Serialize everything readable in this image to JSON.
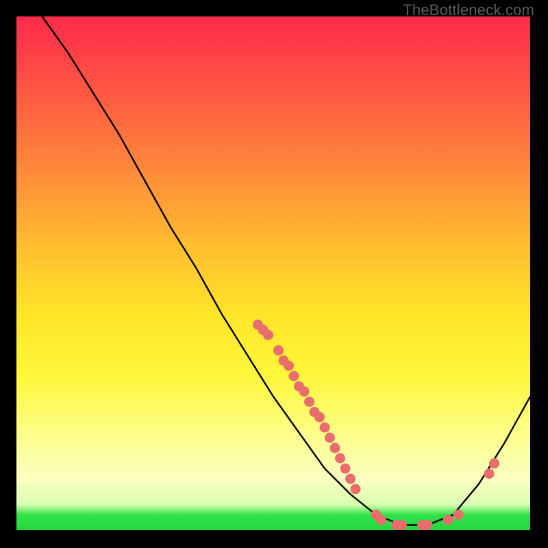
{
  "watermark": "TheBottleneck.com",
  "chart_data": {
    "type": "line",
    "title": "",
    "xlabel": "",
    "ylabel": "",
    "xlim": [
      0,
      100
    ],
    "ylim": [
      0,
      100
    ],
    "grid": false,
    "legend": false,
    "curve": [
      {
        "x": 5,
        "y": 100
      },
      {
        "x": 10,
        "y": 93
      },
      {
        "x": 15,
        "y": 85
      },
      {
        "x": 20,
        "y": 77
      },
      {
        "x": 25,
        "y": 68
      },
      {
        "x": 30,
        "y": 59
      },
      {
        "x": 35,
        "y": 51
      },
      {
        "x": 40,
        "y": 42
      },
      {
        "x": 45,
        "y": 34
      },
      {
        "x": 50,
        "y": 26
      },
      {
        "x": 55,
        "y": 19
      },
      {
        "x": 60,
        "y": 12
      },
      {
        "x": 65,
        "y": 7
      },
      {
        "x": 70,
        "y": 3
      },
      {
        "x": 75,
        "y": 1
      },
      {
        "x": 80,
        "y": 1
      },
      {
        "x": 85,
        "y": 3
      },
      {
        "x": 90,
        "y": 9
      },
      {
        "x": 95,
        "y": 17
      },
      {
        "x": 100,
        "y": 26
      }
    ],
    "data_points": [
      {
        "x": 47,
        "y": 40
      },
      {
        "x": 48,
        "y": 39
      },
      {
        "x": 49,
        "y": 38
      },
      {
        "x": 51,
        "y": 35
      },
      {
        "x": 52,
        "y": 33
      },
      {
        "x": 53,
        "y": 32
      },
      {
        "x": 54,
        "y": 30
      },
      {
        "x": 55,
        "y": 28
      },
      {
        "x": 56,
        "y": 27
      },
      {
        "x": 57,
        "y": 25
      },
      {
        "x": 58,
        "y": 23
      },
      {
        "x": 59,
        "y": 22
      },
      {
        "x": 60,
        "y": 20
      },
      {
        "x": 61,
        "y": 18
      },
      {
        "x": 62,
        "y": 16
      },
      {
        "x": 63,
        "y": 14
      },
      {
        "x": 64,
        "y": 12
      },
      {
        "x": 65,
        "y": 10
      },
      {
        "x": 66,
        "y": 8
      },
      {
        "x": 70,
        "y": 3
      },
      {
        "x": 71,
        "y": 2
      },
      {
        "x": 74,
        "y": 1
      },
      {
        "x": 75,
        "y": 1
      },
      {
        "x": 79,
        "y": 1
      },
      {
        "x": 80,
        "y": 1
      },
      {
        "x": 84,
        "y": 2
      },
      {
        "x": 86,
        "y": 3
      },
      {
        "x": 92,
        "y": 11
      },
      {
        "x": 93,
        "y": 13
      }
    ],
    "colors": {
      "curve": "#000000",
      "points_fill": "#e96d6d",
      "points_stroke": "#c94f4f",
      "gradient_top": "#ff2a4b",
      "gradient_mid": "#ffe528",
      "gradient_bottom_band": "#22d83d"
    }
  }
}
